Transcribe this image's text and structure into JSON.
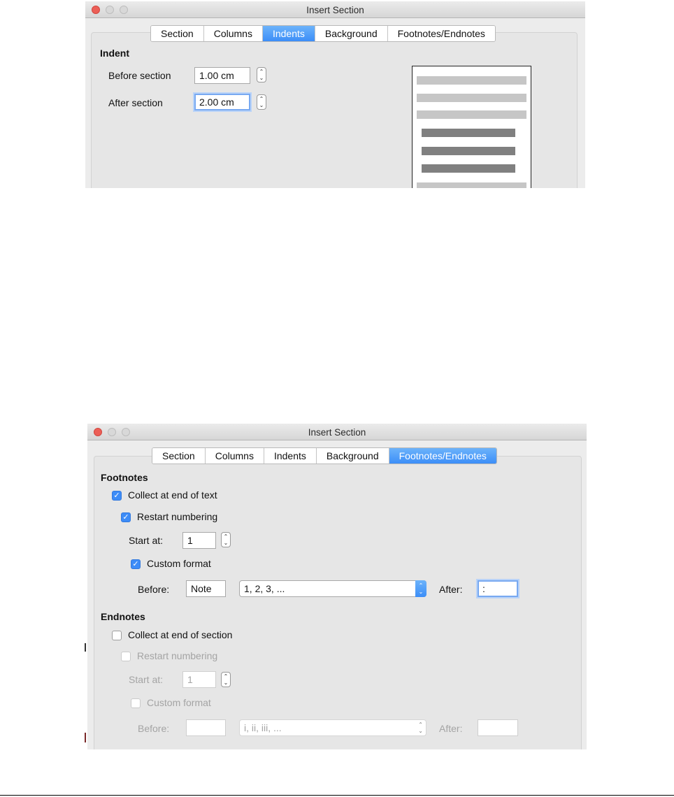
{
  "window1": {
    "title": "Insert Section",
    "tabs": [
      "Section",
      "Columns",
      "Indents",
      "Background",
      "Footnotes/Endnotes"
    ],
    "active_tab": "Indents",
    "indent_heading": "Indent",
    "before_section_label": "Before section",
    "before_section_value": "1.00 cm",
    "after_section_label": "After section",
    "after_section_value": "2.00 cm"
  },
  "window2": {
    "title": "Insert Section",
    "tabs": [
      "Section",
      "Columns",
      "Indents",
      "Background",
      "Footnotes/Endnotes"
    ],
    "active_tab": "Footnotes/Endnotes",
    "footnotes": {
      "heading": "Footnotes",
      "collect_label": "Collect at end of text",
      "collect_checked": true,
      "restart_label": "Restart numbering",
      "restart_checked": true,
      "start_at_label": "Start at:",
      "start_at_value": "1",
      "custom_format_label": "Custom format",
      "custom_format_checked": true,
      "before_label": "Before:",
      "before_value": "Note",
      "format_value": "1, 2, 3, ...",
      "after_label": "After:",
      "after_value": ":"
    },
    "endnotes": {
      "heading": "Endnotes",
      "collect_label": "Collect at end of section",
      "collect_checked": false,
      "restart_label": "Restart numbering",
      "restart_checked": false,
      "start_at_label": "Start at:",
      "start_at_value": "1",
      "custom_format_label": "Custom format",
      "custom_format_checked": false,
      "before_label": "Before:",
      "before_value": "",
      "format_value": "i, ii, iii, ...",
      "after_label": "After:",
      "after_value": ""
    }
  },
  "colors": {
    "accent": "#3d8cf7",
    "close_button": "#ec5f57"
  }
}
